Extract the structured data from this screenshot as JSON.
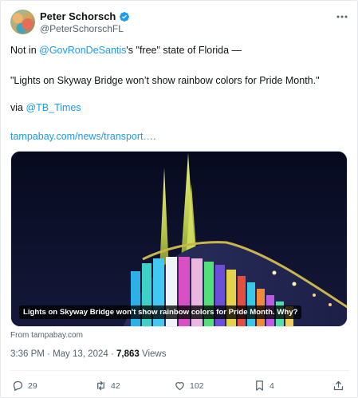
{
  "author": {
    "display_name": "Peter Schorsch",
    "handle": "@PeterSchorschFL"
  },
  "tweet": {
    "line1_prefix": "Not in ",
    "line1_mention": "@GovRonDeSantis",
    "line1_suffix": "'s \"free\" state of Florida —",
    "line2": "\"Lights on Skyway Bridge won’t show rainbow colors for Pride Month.\"",
    "line3_prefix": "via ",
    "line3_mention": "@TB_Times",
    "link_text": "tampabay.com/news/transport…."
  },
  "media": {
    "caption": "Lights on Skyway Bridge won't show rainbow colors for Pride Month. Why?",
    "source": "From tampabay.com"
  },
  "meta": {
    "time": "3:36 PM",
    "date": "May 13, 2024",
    "views_count": "7,863",
    "views_label": "Views",
    "separator": "·"
  },
  "actions": {
    "replies": "29",
    "reposts": "42",
    "likes": "102",
    "bookmarks": "4"
  },
  "colors": {
    "accent": "#1d9bf0",
    "text": "#0f1419",
    "secondary": "#536471"
  }
}
